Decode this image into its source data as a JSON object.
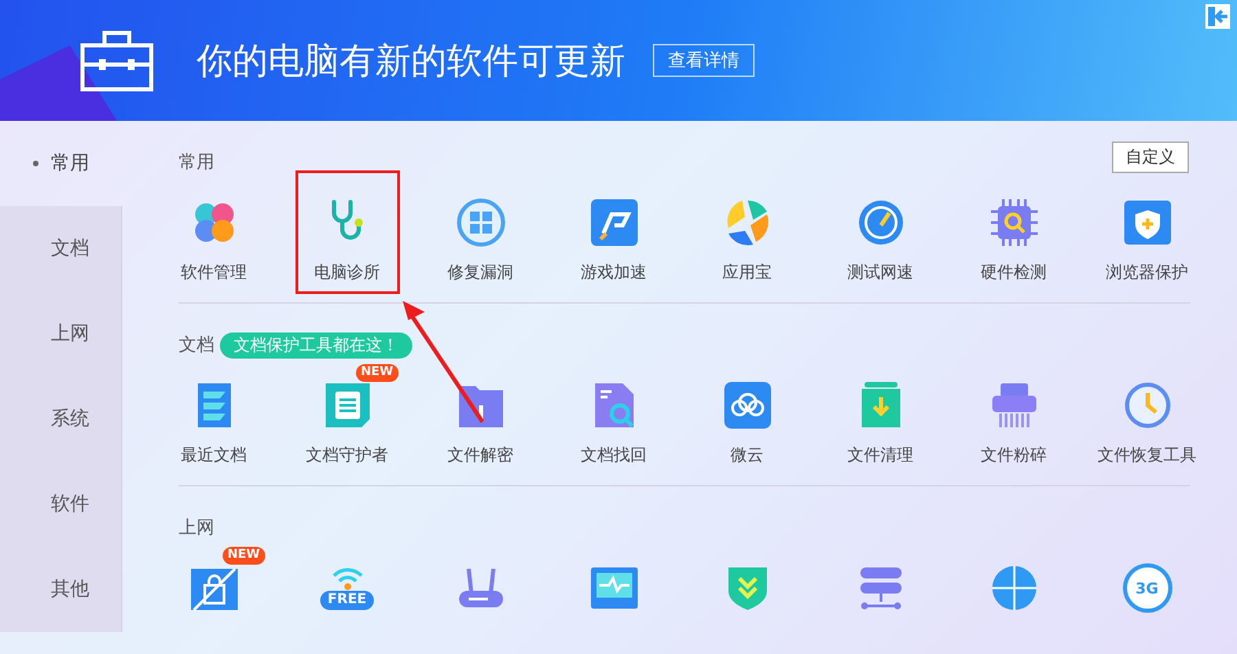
{
  "banner": {
    "title": "你的电脑有新的软件可更新",
    "button": "查看详情"
  },
  "sidebar": {
    "items": [
      {
        "label": "常用",
        "selected": true
      },
      {
        "label": "文档",
        "selected": false
      },
      {
        "label": "上网",
        "selected": false
      },
      {
        "label": "系统",
        "selected": false
      },
      {
        "label": "软件",
        "selected": false
      },
      {
        "label": "其他",
        "selected": false
      }
    ]
  },
  "customize_button": "自定义",
  "annotation_arrow": true,
  "sections": [
    {
      "title": "常用",
      "items": [
        {
          "label": "软件管理",
          "highlighted": false
        },
        {
          "label": "电脑诊所",
          "highlighted": true
        },
        {
          "label": "修复漏洞",
          "highlighted": false
        },
        {
          "label": "游戏加速",
          "highlighted": false
        },
        {
          "label": "应用宝",
          "highlighted": false
        },
        {
          "label": "测试网速",
          "highlighted": false
        },
        {
          "label": "硬件检测",
          "highlighted": false
        },
        {
          "label": "浏览器保护",
          "highlighted": false
        }
      ]
    },
    {
      "title": "文档",
      "tip": "文档保护工具都在这！",
      "items": [
        {
          "label": "最近文档",
          "highlighted": false
        },
        {
          "label": "文档守护者",
          "highlighted": false,
          "badge": "NEW"
        },
        {
          "label": "文件解密",
          "highlighted": false
        },
        {
          "label": "文档找回",
          "highlighted": false
        },
        {
          "label": "微云",
          "highlighted": false
        },
        {
          "label": "文件清理",
          "highlighted": false
        },
        {
          "label": "文件粉碎",
          "highlighted": false
        },
        {
          "label": "文件恢复工具",
          "highlighted": false
        }
      ]
    },
    {
      "title": "上网",
      "items": [
        {
          "highlighted": false,
          "badge": "NEW"
        },
        {
          "highlighted": false,
          "icon_text": "FREE"
        },
        {
          "highlighted": false
        },
        {
          "highlighted": false
        },
        {
          "highlighted": false
        },
        {
          "highlighted": false
        },
        {
          "highlighted": false
        },
        {
          "highlighted": false,
          "icon_text": "3G"
        }
      ]
    }
  ]
}
